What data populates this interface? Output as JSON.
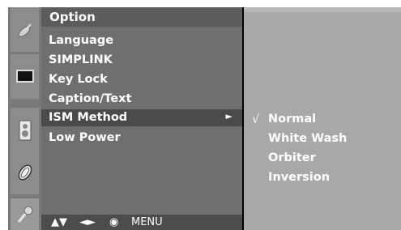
{
  "colors": {
    "background": "#000000",
    "icon_strip": "#7a7a7a",
    "option_panel": "#6f6f6f",
    "option_header": "#5c5c5c",
    "selected_row": "#4a4a4a",
    "sub_panel": "#a8a8a8",
    "text": "#ffffff"
  },
  "sidebar": {
    "icons": [
      {
        "name": "satellite-dish-icon"
      },
      {
        "name": "screen-icon"
      },
      {
        "name": "speaker-icon"
      },
      {
        "name": "clock-icon"
      },
      {
        "name": "option-icon"
      }
    ]
  },
  "option_menu": {
    "title": "Option",
    "items": [
      {
        "label": "Language"
      },
      {
        "label": "SIMPLINK"
      },
      {
        "label": "Key Lock"
      },
      {
        "label": "Caption/Text"
      },
      {
        "label": "ISM Method",
        "selected": true
      },
      {
        "label": "Low Power"
      }
    ],
    "selected_arrow": "►"
  },
  "nav_bar": {
    "up_down": "▲▼",
    "left_right": "◄►",
    "ok": "◉",
    "menu": "MENU"
  },
  "ism_submenu": {
    "check_mark": "√",
    "items": [
      {
        "label": "Normal",
        "checked": true
      },
      {
        "label": "White Wash",
        "checked": false
      },
      {
        "label": "Orbiter",
        "checked": false
      },
      {
        "label": "Inversion",
        "checked": false
      }
    ]
  }
}
